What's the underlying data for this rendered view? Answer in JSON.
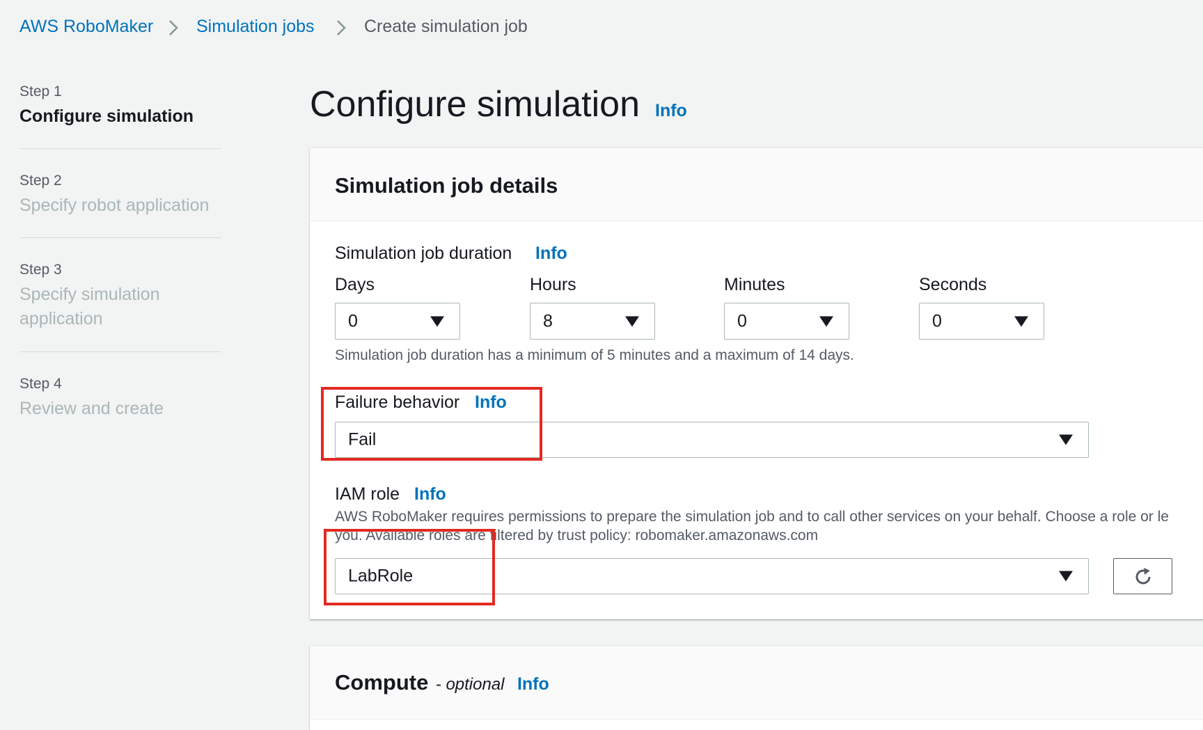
{
  "breadcrumb": {
    "items": [
      {
        "label": "AWS RoboMaker"
      },
      {
        "label": "Simulation jobs"
      },
      {
        "label": "Create simulation job"
      }
    ]
  },
  "steps": [
    {
      "number": "Step 1",
      "title": "Configure simulation"
    },
    {
      "number": "Step 2",
      "title": "Specify robot application"
    },
    {
      "number": "Step 3",
      "title_line1": "Specify simulation",
      "title_line2": "application"
    },
    {
      "number": "Step 4",
      "title": "Review and create"
    }
  ],
  "page": {
    "title": "Configure simulation",
    "info": "Info"
  },
  "job_details": {
    "title": "Simulation job details",
    "duration": {
      "label": "Simulation job duration",
      "info": "Info",
      "fields": [
        {
          "label": "Days",
          "value": "0"
        },
        {
          "label": "Hours",
          "value": "8"
        },
        {
          "label": "Minutes",
          "value": "0"
        },
        {
          "label": "Seconds",
          "value": "0"
        }
      ],
      "hint": "Simulation job duration has a minimum of 5 minutes and a maximum of 14 days."
    },
    "failure_behavior": {
      "label": "Failure behavior",
      "info": "Info",
      "value": "Fail"
    },
    "iam_role": {
      "label": "IAM role",
      "info": "Info",
      "desc_line1": "AWS RoboMaker requires permissions to prepare the simulation job and to call other services on your behalf. Choose a role or le",
      "desc_line2": "you. Available roles are filtered by trust policy: robomaker.amazonaws.com",
      "value": "LabRole"
    }
  },
  "compute": {
    "title": "Compute",
    "optional": "- optional",
    "info": "Info"
  },
  "colors": {
    "link": "#0073bb",
    "highlight": "#e22a20",
    "background": "#f2f3f3"
  },
  "icons": [
    "chevron-right-icon",
    "caret-down-icon",
    "refresh-icon"
  ]
}
